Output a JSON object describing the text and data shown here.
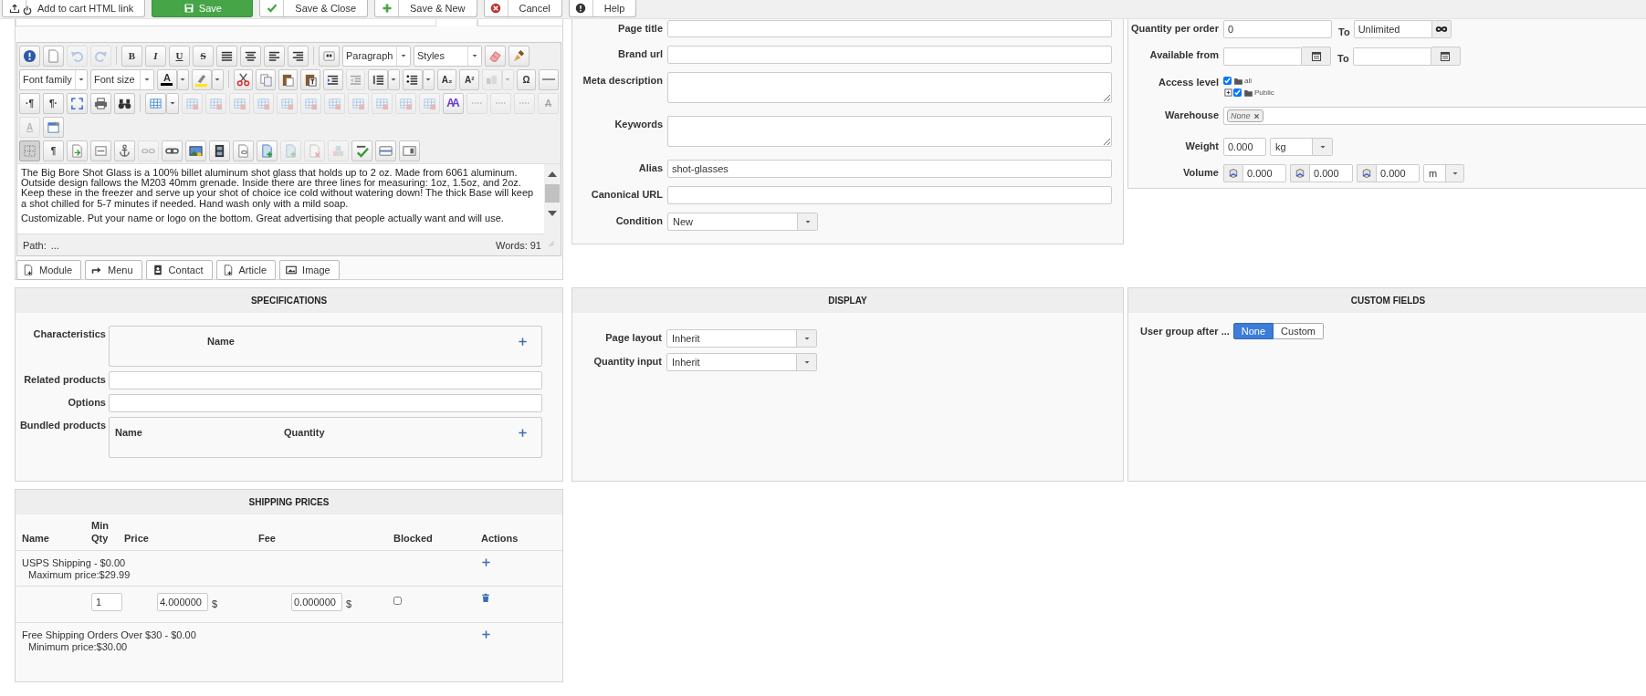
{
  "toolbar": {
    "buttons": [
      {
        "kind": "upload",
        "label": "Add to cart HTML link"
      },
      {
        "kind": "save",
        "label": "Save"
      },
      {
        "kind": "check",
        "label": "Save & Close"
      },
      {
        "kind": "plus",
        "label": "Save & New"
      },
      {
        "kind": "cancel",
        "label": "Cancel"
      },
      {
        "kind": "help",
        "label": "Help"
      }
    ]
  },
  "editor": {
    "toolbar_rows": [
      [
        {
          "kind": "help",
          "disabled": false,
          "active": false
        },
        {
          "kind": "newdoc",
          "disabled": false,
          "active": false
        },
        {
          "kind": "undo",
          "disabled": true,
          "active": false
        },
        {
          "kind": "redo",
          "disabled": true,
          "active": false
        },
        {
          "kind": "sep"
        },
        {
          "kind": "bold",
          "label": "B",
          "disabled": false,
          "active": false
        },
        {
          "kind": "italic",
          "label": "I",
          "disabled": false,
          "active": false
        },
        {
          "kind": "underline",
          "label": "U",
          "disabled": false,
          "active": false
        },
        {
          "kind": "strike",
          "label": "S",
          "disabled": false,
          "active": false
        },
        {
          "kind": "justify",
          "disabled": false,
          "active": false
        },
        {
          "kind": "aligncenter",
          "disabled": false,
          "active": false
        },
        {
          "kind": "alignleft",
          "disabled": false,
          "active": false
        },
        {
          "kind": "alignright",
          "disabled": false,
          "active": false
        },
        {
          "kind": "sep"
        },
        {
          "kind": "blockquote",
          "disabled": false,
          "active": false
        },
        {
          "kind": "select",
          "label": "Paragraph",
          "disabled": false,
          "active": false
        },
        {
          "kind": "select",
          "label": "Styles",
          "disabled": false,
          "active": false
        },
        {
          "kind": "eraser",
          "disabled": false,
          "active": false
        },
        {
          "kind": "brush",
          "disabled": false,
          "active": false
        }
      ],
      [
        {
          "kind": "select",
          "label": "Font family",
          "disabled": false,
          "active": false
        },
        {
          "kind": "select",
          "label": "Font size",
          "disabled": false,
          "active": false
        },
        {
          "kind": "forecolor",
          "label": "A",
          "disabled": false,
          "active": false
        },
        {
          "kind": "arrow",
          "disabled": false,
          "active": false
        },
        {
          "kind": "highlight",
          "disabled": false,
          "active": false
        },
        {
          "kind": "arrow",
          "disabled": false,
          "active": false
        },
        {
          "kind": "sep"
        },
        {
          "kind": "cut",
          "disabled": false,
          "active": false
        },
        {
          "kind": "copy",
          "disabled": false,
          "active": false
        },
        {
          "kind": "paste",
          "disabled": false,
          "active": false
        },
        {
          "kind": "pastetext",
          "disabled": false,
          "active": false
        },
        {
          "kind": "indent",
          "disabled": false,
          "active": false
        },
        {
          "kind": "outdent",
          "disabled": true,
          "active": false
        },
        {
          "kind": "olist",
          "disabled": false,
          "active": false
        },
        {
          "kind": "arrow",
          "disabled": false,
          "active": false
        },
        {
          "kind": "ulist",
          "disabled": false,
          "active": false
        },
        {
          "kind": "arrow",
          "disabled": false,
          "active": false
        },
        {
          "kind": "sub",
          "label": "A₂",
          "disabled": false,
          "active": false
        },
        {
          "kind": "sup",
          "label": "A²",
          "disabled": false,
          "active": false
        },
        {
          "kind": "textcase",
          "disabled": true,
          "active": false
        },
        {
          "kind": "arrow",
          "disabled": true,
          "active": false
        },
        {
          "kind": "charmap",
          "label": "Ω",
          "disabled": false,
          "active": false
        },
        {
          "kind": "hr",
          "disabled": false,
          "active": false
        }
      ],
      [
        {
          "kind": "ltr",
          "label": "·¶",
          "disabled": false,
          "active": false
        },
        {
          "kind": "rtl",
          "label": "¶·",
          "disabled": false,
          "active": false
        },
        {
          "kind": "fullscreen",
          "disabled": false,
          "active": false
        },
        {
          "kind": "print",
          "disabled": false,
          "active": false
        },
        {
          "kind": "find",
          "disabled": false,
          "active": false
        },
        {
          "kind": "sep"
        },
        {
          "kind": "table",
          "disabled": false,
          "active": false
        },
        {
          "kind": "arrow",
          "disabled": false,
          "active": false
        },
        {
          "kind": "tableop",
          "disabled": true,
          "active": false
        },
        {
          "kind": "tableop",
          "disabled": true,
          "active": false
        },
        {
          "kind": "tableop",
          "disabled": true,
          "active": false
        },
        {
          "kind": "tableop",
          "disabled": true,
          "active": false
        },
        {
          "kind": "tableop",
          "disabled": true,
          "active": false
        },
        {
          "kind": "tableop",
          "disabled": true,
          "active": false
        },
        {
          "kind": "tableop",
          "disabled": true,
          "active": false
        },
        {
          "kind": "tableop",
          "disabled": true,
          "active": false
        },
        {
          "kind": "tableop",
          "disabled": true,
          "active": false
        },
        {
          "kind": "tableop",
          "disabled": true,
          "active": false
        },
        {
          "kind": "tableop",
          "disabled": true,
          "active": false
        },
        {
          "kind": "styleprops",
          "label": "AA",
          "disabled": false,
          "active": false
        },
        {
          "kind": "cite",
          "disabled": true,
          "active": false
        },
        {
          "kind": "cite",
          "disabled": true,
          "active": false
        },
        {
          "kind": "cite",
          "disabled": true,
          "active": false
        },
        {
          "kind": "del",
          "label": "A",
          "disabled": true,
          "active": false
        }
      ],
      [
        {
          "kind": "ins",
          "label": "A",
          "disabled": true,
          "active": false
        },
        {
          "kind": "template",
          "disabled": false,
          "active": false
        }
      ],
      [
        {
          "kind": "visualaid",
          "disabled": false,
          "active": true
        },
        {
          "kind": "pilcrow",
          "label": "¶",
          "disabled": false,
          "active": false
        },
        {
          "kind": "insertfile",
          "disabled": false,
          "active": false
        },
        {
          "kind": "pagebreak",
          "disabled": false,
          "active": false
        },
        {
          "kind": "anchor",
          "disabled": false,
          "active": false
        },
        {
          "kind": "unlink",
          "disabled": true,
          "active": false
        },
        {
          "kind": "link",
          "disabled": false,
          "active": false
        },
        {
          "kind": "image",
          "disabled": false,
          "active": false
        },
        {
          "kind": "media",
          "disabled": false,
          "active": false
        },
        {
          "kind": "fileattach",
          "disabled": false,
          "active": false
        },
        {
          "kind": "docadd",
          "disabled": false,
          "active": false
        },
        {
          "kind": "docadd",
          "disabled": true,
          "active": false
        },
        {
          "kind": "docremove",
          "disabled": true,
          "active": false
        },
        {
          "kind": "blocks",
          "disabled": true,
          "active": false
        },
        {
          "kind": "spellcheck",
          "disabled": false,
          "active": false
        },
        {
          "kind": "hrbox",
          "disabled": false,
          "active": false
        },
        {
          "kind": "boxright",
          "disabled": false,
          "active": false
        }
      ]
    ],
    "content": [
      "The Big Bore Shot Glass is a 100% billet aluminum shot glass that holds up to 2 oz. Made from 6061 aluminum. Outside design fallows the M203 40mm grenade. Inside there are three lines for measuring: 1oz, 1.5oz, and 2oz. Keep these in the freezer and serve up your shot of choice ice cold without watering down! The thick Base will keep a shot chilled for 5-7 minutes if needed. Hand wash only with a mild soap.",
      "Customizable. Put your name or logo on the bottom. Great advertising that people actually want and will use."
    ],
    "path_label": "Path:",
    "path": "...",
    "word_count": "Words: 91",
    "insert_buttons": [
      {
        "kind": "module",
        "label": "Module"
      },
      {
        "kind": "menu",
        "label": "Menu"
      },
      {
        "kind": "contact",
        "label": "Contact"
      },
      {
        "kind": "article",
        "label": "Article"
      },
      {
        "kind": "image",
        "label": "Image"
      }
    ]
  },
  "seo": {
    "fields": [
      {
        "kind": "input",
        "label": "Page title"
      },
      {
        "kind": "input",
        "label": "Brand url"
      },
      {
        "kind": "textarea",
        "label": "Meta description"
      },
      {
        "kind": "textarea",
        "label": "Keywords"
      },
      {
        "kind": "input",
        "label": "Alias",
        "value": "shot-glasses"
      },
      {
        "kind": "input",
        "label": "Canonical URL"
      },
      {
        "kind": "select",
        "label": "Condition",
        "value": "New"
      }
    ]
  },
  "stock": {
    "quantity_per_order": {
      "label": "Quantity per order",
      "from": "0",
      "to_label": "To",
      "to": "Unlimited"
    },
    "available_from": {
      "label": "Available from",
      "to_label": "To"
    },
    "access_level": {
      "label": "Access level",
      "tree": [
        {
          "label": "all",
          "checked": true,
          "children": [
            {
              "label": "Public",
              "checked": true,
              "expanded": false
            }
          ]
        }
      ]
    },
    "warehouse": {
      "label": "Warehouse",
      "tags": [
        "None"
      ]
    },
    "weight": {
      "label": "Weight",
      "value": "0.000",
      "unit": "kg"
    },
    "volume": {
      "label": "Volume",
      "values": [
        "0.000",
        "0.000",
        "0.000"
      ],
      "unit": "m"
    }
  },
  "specifications": {
    "title": "SPECIFICATIONS",
    "characteristics": {
      "label": "Characteristics",
      "columns": [
        "Name"
      ]
    },
    "related_products": {
      "label": "Related products"
    },
    "options": {
      "label": "Options"
    },
    "bundled_products": {
      "label": "Bundled products",
      "columns": [
        "Name",
        "Quantity"
      ]
    }
  },
  "display": {
    "title": "DISPLAY",
    "fields": [
      {
        "label": "Page layout",
        "value": "Inherit"
      },
      {
        "label": "Quantity input",
        "value": "Inherit"
      }
    ]
  },
  "custom_fields": {
    "title": "CUSTOM FIELDS",
    "fields": [
      {
        "label": "User group after ...",
        "options": [
          {
            "label": "None",
            "selected": true
          },
          {
            "label": "Custom",
            "selected": false
          }
        ]
      }
    ]
  },
  "shipping_prices": {
    "title": "SHIPPING PRICES",
    "columns": [
      "Name",
      "Min Qty",
      "Price",
      "Fee",
      "Blocked",
      "Actions"
    ],
    "groups": [
      {
        "name": "USPS Shipping - $0.00",
        "limit": "Maximum price:$29.99",
        "rows": [
          {
            "min_qty": "1",
            "price": "4.000000",
            "price_unit": "$",
            "fee": "0.000000",
            "fee_unit": "$",
            "blocked": false
          }
        ]
      },
      {
        "name": "Free Shipping Orders Over $30 - $0.00",
        "limit": "Minimum price:$30.00"
      }
    ]
  }
}
